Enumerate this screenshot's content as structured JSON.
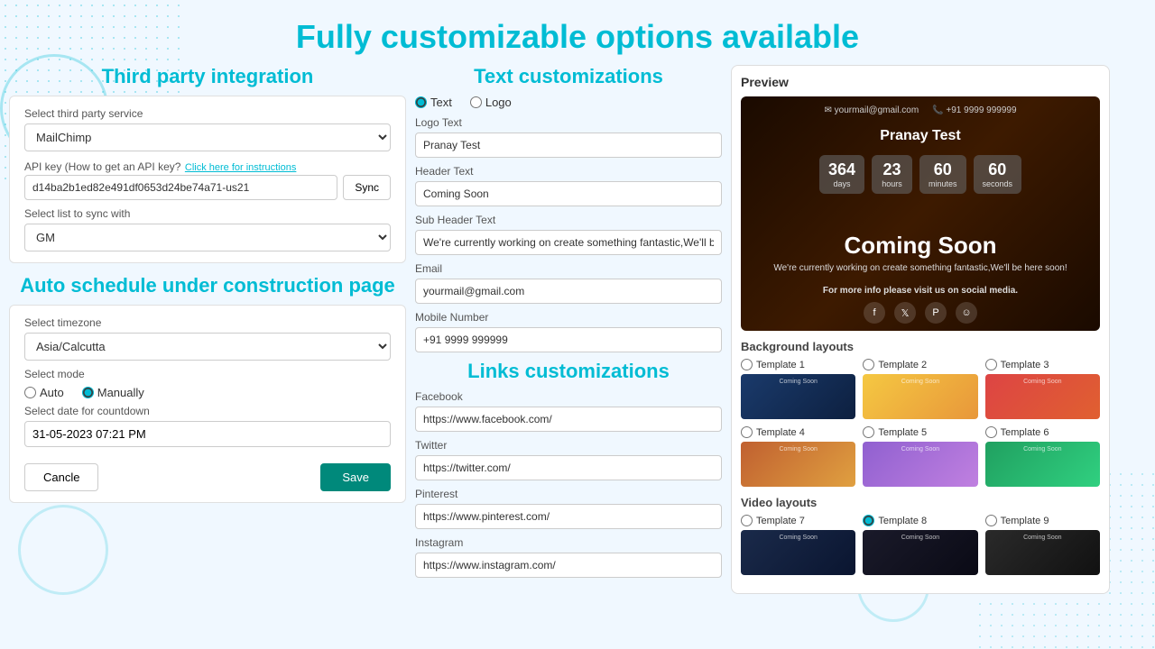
{
  "page": {
    "title": "Fully customizable options available"
  },
  "third_party": {
    "section_title": "Third party integration",
    "select_service_label": "Select third party service",
    "service_value": "MailChimp",
    "api_key_label": "API key (How to get an API key?",
    "api_key_link": "Click here for instructions",
    "api_key_value": "d14ba2b1ed82e491df0653d24be74a71-us21",
    "sync_btn": "Sync",
    "select_list_label": "Select list to sync with",
    "list_value": "GM"
  },
  "auto_schedule": {
    "section_title": "Auto schedule under construction page",
    "timezone_label": "Select timezone",
    "timezone_value": "Asia/Calcutta",
    "mode_label": "Select mode",
    "mode_auto": "Auto",
    "mode_manually": "Manually",
    "date_label": "Select date for countdown",
    "date_value": "31-05-2023 07:21 PM",
    "cancel_btn": "Cancle",
    "save_btn": "Save"
  },
  "text_customizations": {
    "section_title": "Text customizations",
    "text_radio": "Text",
    "logo_radio": "Logo",
    "logo_text_label": "Logo Text",
    "logo_text_value": "Pranay Test",
    "header_text_label": "Header Text",
    "header_text_value": "Coming Soon",
    "sub_header_label": "Sub Header Text",
    "sub_header_value": "We're currently working on create something fantastic,We'll be here soon!",
    "email_label": "Email",
    "email_value": "yourmail@gmail.com",
    "mobile_label": "Mobile Number",
    "mobile_value": "+91 9999 999999"
  },
  "links_customizations": {
    "section_title": "Links customizations",
    "facebook_label": "Facebook",
    "facebook_value": "https://www.facebook.com/",
    "twitter_label": "Twitter",
    "twitter_value": "https://twitter.com/",
    "pinterest_label": "Pinterest",
    "pinterest_value": "https://www.pinterest.com/",
    "instagram_label": "Instagram",
    "instagram_value": "https://www.instagram.com/"
  },
  "preview": {
    "title": "Preview",
    "email": "yourmail@gmail.com",
    "phone": "+91 9999 999999",
    "name": "Pranay Test",
    "days": "364",
    "hours": "23",
    "minutes": "60",
    "seconds": "60",
    "days_label": "days",
    "hours_label": "hours",
    "minutes_label": "minutes",
    "seconds_label": "seconds",
    "coming_soon": "Coming Soon",
    "subtitle": "We're currently working on create something fantastic,We'll be here soon!",
    "visit_text": "For more info please visit us on social media.",
    "background_layouts": "Background layouts",
    "video_layouts": "Video layouts",
    "templates": [
      {
        "label": "Template 1",
        "selected": false
      },
      {
        "label": "Template 2",
        "selected": false
      },
      {
        "label": "Template 3",
        "selected": false
      },
      {
        "label": "Template 4",
        "selected": false
      },
      {
        "label": "Template 5",
        "selected": false
      },
      {
        "label": "Template 6",
        "selected": false
      },
      {
        "label": "Template 7",
        "selected": false
      },
      {
        "label": "Template 8",
        "selected": true
      },
      {
        "label": "Template 9",
        "selected": false
      }
    ]
  }
}
